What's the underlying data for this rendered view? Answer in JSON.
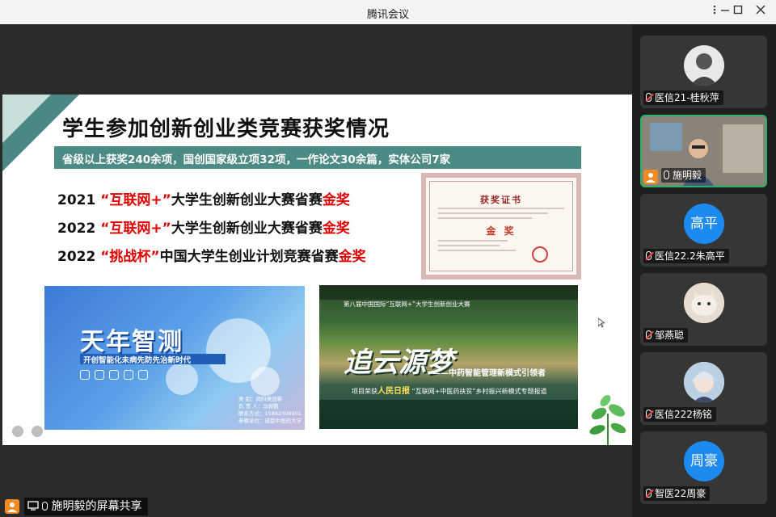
{
  "window": {
    "title": "腾讯会议",
    "controls": [
      "settings-icon",
      "minimize-icon",
      "maximize-icon",
      "close-icon"
    ]
  },
  "slide": {
    "title": "学生参加创新创业类竞赛获奖情况",
    "subtitle": "省级以上获奖240余项，国创国家级立项32项，一作论文30余篇，实体公司7家",
    "awards": [
      {
        "year": "2021",
        "contest": "“互联网+”",
        "desc": "大学生创新创业大赛省赛",
        "prize": "金奖"
      },
      {
        "year": "2022",
        "contest": "“互联网+”",
        "desc": "大学生创新创业大赛省赛",
        "prize": "金奖"
      },
      {
        "year": "2022",
        "contest": "“挑战杯”",
        "desc": "中国大学生创业计划竞赛省赛",
        "prize": "金奖"
      }
    ],
    "certificate": {
      "title": "获奖证书",
      "prize": "金 奖"
    },
    "poster1": {
      "title": "天年智测",
      "tagline": "开创智能化未病先防先治新时代",
      "details": [
        "类 别：商科类创新",
        "负 责 人：马俊鹏",
        "联系方式：15882306901",
        "参赛单位：成都中医药大学"
      ]
    },
    "poster2": {
      "title": "追云源梦",
      "subtitle": "——中药智能管理新模式引领者",
      "top_strip": "第八届中国国际“互联网+”大学生创新创业大赛",
      "line_prefix": "项目荣获",
      "line_highlight": "人民日报",
      "line_suffix": "“互联网+中医药扶贫”乡村振兴新模式专题报道"
    }
  },
  "share": {
    "label": "施明毅的屏幕共享"
  },
  "participants": [
    {
      "name": "医信21-桂秋萍",
      "type": "photo",
      "muted": true
    },
    {
      "name": "施明毅",
      "type": "video",
      "muted": false,
      "active": true
    },
    {
      "name": "医信22.2朱高平",
      "type": "initials",
      "initials": "高平",
      "muted": true
    },
    {
      "name": "邹燕聪",
      "type": "photo",
      "muted": true
    },
    {
      "name": "医信222杨铭",
      "type": "photo",
      "muted": true
    },
    {
      "name": "智医22周豪",
      "type": "initials",
      "initials": "周豪",
      "muted": true
    }
  ],
  "colors": {
    "accent_teal": "#4c8a86",
    "award_red": "#e00000",
    "avatar_blue": "#1d8af0",
    "active_border": "#29b36a"
  }
}
